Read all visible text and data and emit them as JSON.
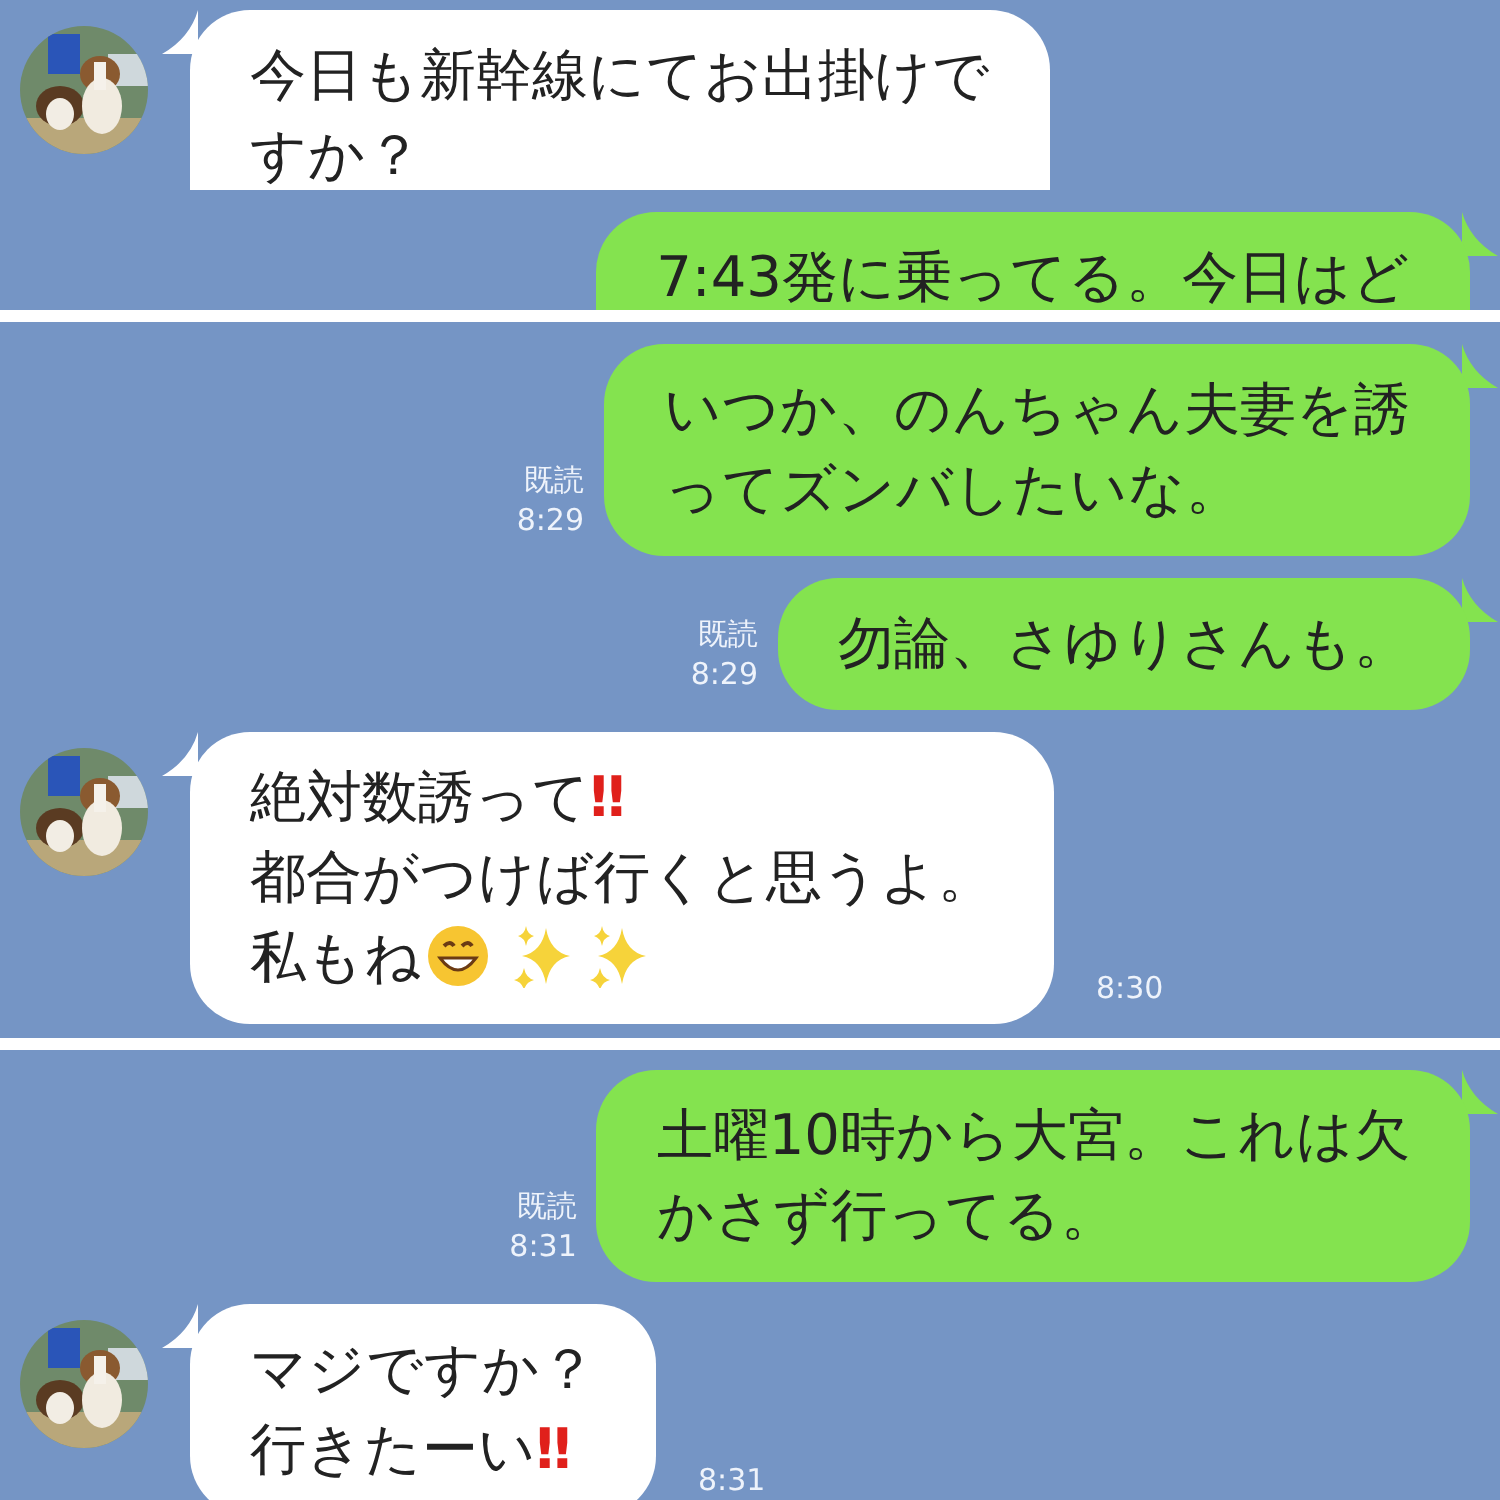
{
  "panels": [
    {
      "messages": [
        {
          "kind": "incoming",
          "cut": true,
          "lines": [
            [
              {
                "kind": "text",
                "text": "今日も新幹線にてお出掛けで"
              }
            ],
            [
              {
                "kind": "text",
                "text": "すか？"
              }
            ]
          ]
        },
        {
          "kind": "outgoing",
          "cut": true,
          "lines": [
            [
              {
                "kind": "text",
                "text": "7:43発に乗ってる。今日はど"
              }
            ]
          ]
        }
      ]
    },
    {
      "messages": [
        {
          "kind": "outgoing",
          "cut": false,
          "read": "既読",
          "time": "8:29",
          "lines": [
            [
              {
                "kind": "text",
                "text": "いつか、のんちゃん夫妻を誘"
              }
            ],
            [
              {
                "kind": "text",
                "text": "ってズンバしたいな。"
              }
            ]
          ]
        },
        {
          "kind": "outgoing",
          "cut": false,
          "read": "既読",
          "time": "8:29",
          "lines": [
            [
              {
                "kind": "text",
                "text": "勿論、さゆりさんも。"
              }
            ]
          ]
        },
        {
          "kind": "incoming",
          "cut": false,
          "time": "8:30",
          "lines": [
            [
              {
                "kind": "text",
                "text": "絶対数誘って"
              },
              {
                "kind": "exclaim",
                "text": "‼"
              }
            ],
            [
              {
                "kind": "text",
                "text": "都合がつけば行くと思うよ。"
              }
            ],
            [
              {
                "kind": "text",
                "text": "私もね"
              },
              {
                "kind": "grin"
              },
              {
                "kind": "sparkles"
              },
              {
                "kind": "sparkles"
              }
            ]
          ]
        }
      ]
    },
    {
      "messages": [
        {
          "kind": "outgoing",
          "cut": false,
          "read": "既読",
          "time": "8:31",
          "lines": [
            [
              {
                "kind": "text",
                "text": "土曜10時から大宮。これは欠"
              }
            ],
            [
              {
                "kind": "text",
                "text": "かさず行ってる。"
              }
            ]
          ]
        },
        {
          "kind": "incoming",
          "cut": false,
          "time": "8:31",
          "lines": [
            [
              {
                "kind": "text",
                "text": "マジですか？"
              }
            ],
            [
              {
                "kind": "text",
                "text": "行きたーい"
              },
              {
                "kind": "exclaim",
                "text": "‼"
              }
            ]
          ]
        }
      ]
    }
  ]
}
